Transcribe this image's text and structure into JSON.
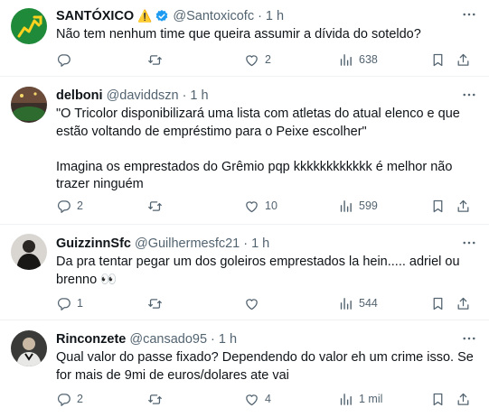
{
  "tweets": [
    {
      "name": "SANTÓXICO",
      "warning_icon": "warning-emoji",
      "verified": true,
      "handle": "@Santoxicofc",
      "dot": "·",
      "time": "1 h",
      "text": "Não tem nenhum time que queira assumir a dívida do soteldo?",
      "replies": "",
      "reposts": "",
      "likes": "2",
      "views": "638"
    },
    {
      "name": "delboni",
      "handle": "@daviddszn",
      "dot": "·",
      "time": "1 h",
      "text": "\"O Tricolor disponibilizará uma lista com atletas do atual elenco e que estão voltando de empréstimo para o Peixe escolher\"\n\nImagina os emprestados do Grêmio pqp kkkkkkkkkkkk é melhor não trazer ninguém",
      "replies": "2",
      "reposts": "",
      "likes": "10",
      "views": "599"
    },
    {
      "name": "GuizzinnSfc",
      "handle": "@Guilhermesfc21",
      "dot": "·",
      "time": "1 h",
      "text": "Da pra tentar pegar um dos goleiros emprestados la hein..... adriel ou brenno 👀",
      "replies": "1",
      "reposts": "",
      "likes": "",
      "views": "544"
    },
    {
      "name": "Rinconzete",
      "handle": "@cansado95",
      "dot": "·",
      "time": "1 h",
      "text": "Qual valor do passe fixado? Dependendo do valor eh um crime isso. Se for mais de 9mi de euros/dolares ate vai",
      "replies": "2",
      "reposts": "",
      "likes": "4",
      "views": "1 mil"
    }
  ],
  "colors": {
    "text": "#0f1419",
    "muted": "#536471",
    "verified": "#1d9bf0",
    "divider": "#eff3f4"
  },
  "icons": [
    "reply-icon",
    "repost-icon",
    "like-icon",
    "views-icon",
    "bookmark-icon",
    "share-icon",
    "more-icon",
    "verified-badge-icon"
  ]
}
